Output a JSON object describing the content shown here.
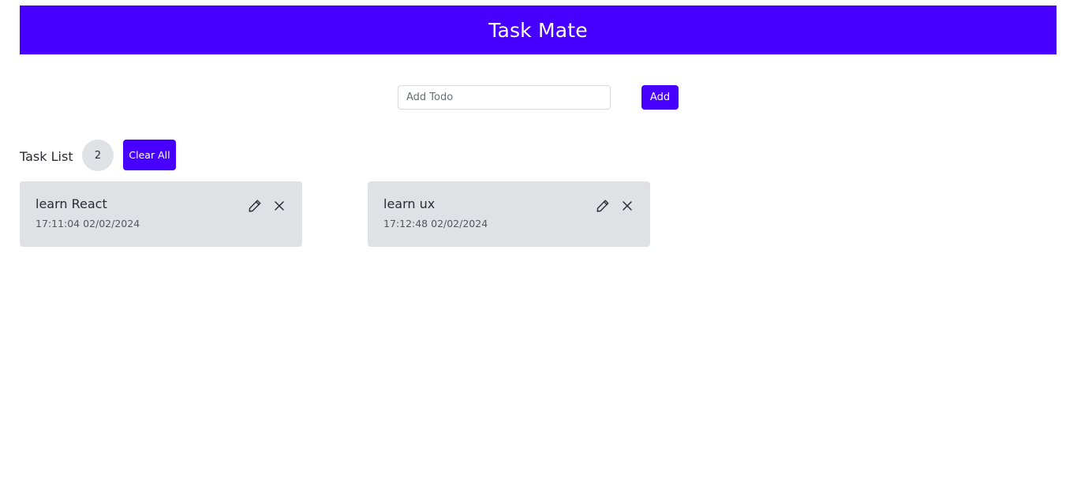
{
  "header": {
    "title": "Task Mate"
  },
  "add_form": {
    "input_placeholder": "Add Todo",
    "input_value": "",
    "add_label": "Add"
  },
  "task_list": {
    "title": "Task List",
    "count": "2",
    "clear_all_label": "Clear All",
    "tasks": [
      {
        "title": "learn React",
        "timestamp": "17:11:04 02/02/2024",
        "edit_icon": "pencil-icon",
        "delete_icon": "close-icon"
      },
      {
        "title": "learn ux",
        "timestamp": "17:12:48 02/02/2024",
        "edit_icon": "pencil-icon",
        "delete_icon": "close-icon"
      }
    ]
  },
  "colors": {
    "accent": "#4700ff",
    "card_background": "#dfe1e5",
    "text": "#2b2b33"
  }
}
